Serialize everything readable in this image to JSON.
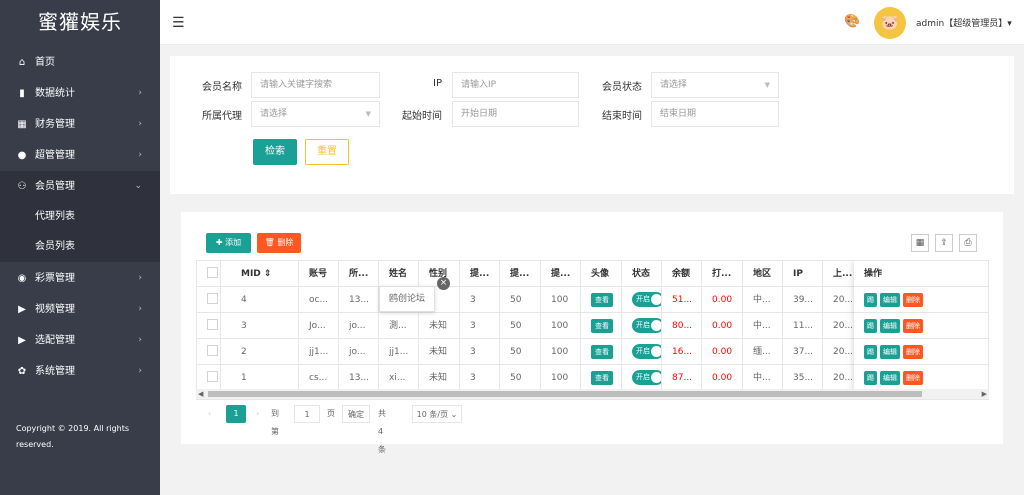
{
  "app": {
    "title": "蜜獾娱乐",
    "copyright": "Copyright © 2019. All rights reserved."
  },
  "sidebar": {
    "items": [
      {
        "label": "首页",
        "icon": "home-icon",
        "glyph": "⌂",
        "arrow": ""
      },
      {
        "label": "数据统计",
        "icon": "bar-chart-icon",
        "glyph": "▮",
        "arrow": "›"
      },
      {
        "label": "财务管理",
        "icon": "bank-icon",
        "glyph": "▦",
        "arrow": "›"
      },
      {
        "label": "超管管理",
        "icon": "user-icon",
        "glyph": "●",
        "arrow": "›"
      },
      {
        "label": "会员管理",
        "icon": "users-icon",
        "glyph": "⚇",
        "arrow": "⌄"
      }
    ],
    "sub_items": [
      {
        "label": "代理列表"
      },
      {
        "label": "会员列表"
      }
    ],
    "items_after": [
      {
        "label": "彩票管理",
        "icon": "gamepad-icon",
        "glyph": "◉",
        "arrow": "›"
      },
      {
        "label": "视频管理",
        "icon": "video-icon",
        "glyph": "▶",
        "arrow": "›"
      },
      {
        "label": "选配管理",
        "icon": "video-icon",
        "glyph": "▶",
        "arrow": "›"
      },
      {
        "label": "系统管理",
        "icon": "gear-icon",
        "glyph": "✿",
        "arrow": "›"
      }
    ]
  },
  "header": {
    "admin_label": "admin【超级管理员】▾"
  },
  "search": {
    "member_name_label": "会员名称",
    "member_name_placeholder": "请输入关键字搜索",
    "ip_label": "IP",
    "ip_placeholder": "请输入IP",
    "status_label": "会员状态",
    "status_placeholder": "请选择",
    "agent_label": "所属代理",
    "agent_placeholder": "请选择",
    "start_label": "起始时间",
    "start_placeholder": "开始日期",
    "end_label": "结束时间",
    "end_placeholder": "结束日期",
    "search_button": "检索",
    "reset_button": "重置"
  },
  "toolbar": {
    "add_label": "✚ 添加",
    "delete_label": "🗑 删除"
  },
  "table": {
    "headers": {
      "mid": "MID ⇕",
      "account": "账号",
      "agent": "所...",
      "name": "姓名",
      "gender": "性别",
      "c1": "提...",
      "c2": "提...",
      "c3": "提...",
      "avatar": "头像",
      "status": "状态",
      "balance": "余额",
      "bet": "打...",
      "region": "地区",
      "ip": "IP",
      "login": "上...",
      "ops": "操作"
    },
    "rows": [
      {
        "mid": "4",
        "account": "oc...",
        "agent": "13...",
        "name": "",
        "gender": "",
        "c1": "3",
        "c2": "50",
        "c3": "100",
        "balance": "51...",
        "bet": "0.00",
        "region": "中...",
        "ip": "39...",
        "login": "20..."
      },
      {
        "mid": "3",
        "account": "Jo...",
        "agent": "jo...",
        "name": "測...",
        "gender": "未知",
        "c1": "3",
        "c2": "50",
        "c3": "100",
        "balance": "80...",
        "bet": "0.00",
        "region": "中...",
        "ip": "11...",
        "login": "20..."
      },
      {
        "mid": "2",
        "account": "jj1...",
        "agent": "jo...",
        "name": "jj1...",
        "gender": "未知",
        "c1": "3",
        "c2": "50",
        "c3": "100",
        "balance": "16...",
        "bet": "0.00",
        "region": "缅...",
        "ip": "37...",
        "login": "20..."
      },
      {
        "mid": "1",
        "account": "cs...",
        "agent": "13...",
        "name": "xi...",
        "gender": "未知",
        "c1": "3",
        "c2": "50",
        "c3": "100",
        "balance": "87...",
        "bet": "0.00",
        "region": "中...",
        "ip": "35...",
        "login": "20..."
      }
    ],
    "view_label": "查看",
    "switch_label": "开启",
    "op1": "踢",
    "op2": "编辑",
    "op3": "删除"
  },
  "tooltip": {
    "text": "鸥创论坛"
  },
  "pager": {
    "current": "1",
    "goto_label": "到第",
    "goto_value": "1",
    "page_label": "页",
    "confirm": "确定",
    "total": "共 4 条",
    "per_page": "10 条/页 ⌄"
  },
  "colors": {
    "sidebar": "#393d49",
    "accent": "#1aa094",
    "danger": "#ff5722",
    "warning": "#fbc02d"
  }
}
